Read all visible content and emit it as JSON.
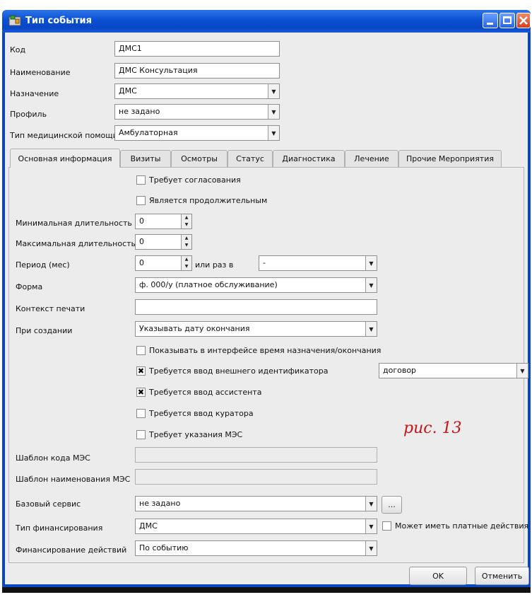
{
  "window": {
    "title": "Тип события"
  },
  "header_fields": {
    "code": {
      "label": "Код",
      "value": "ДМС1"
    },
    "name": {
      "label": "Наименование",
      "value": "ДМС Консультация"
    },
    "purpose": {
      "label": "Назначение",
      "value": "ДМС"
    },
    "profile": {
      "label": "Профиль",
      "value": "не задано"
    },
    "care_type": {
      "label": "Тип медицинской помощи",
      "value": "Амбулаторная"
    }
  },
  "tabs": [
    {
      "label": "Основная информация",
      "active": true
    },
    {
      "label": "Визиты"
    },
    {
      "label": "Осмотры"
    },
    {
      "label": "Статус"
    },
    {
      "label": "Диагностика"
    },
    {
      "label": "Лечение"
    },
    {
      "label": "Прочие Мероприятия"
    }
  ],
  "main": {
    "requires_approval": {
      "label": "Требует согласования",
      "checked": false
    },
    "is_long": {
      "label": "Является продолжительным",
      "checked": false
    },
    "min_duration": {
      "label": "Минимальная длительность",
      "value": "0"
    },
    "max_duration": {
      "label": "Максимальная длительность",
      "value": "0"
    },
    "period": {
      "label": "Период (мес)",
      "value": "0",
      "or_label": "или раз в",
      "or_value": "-"
    },
    "form": {
      "label": "Форма",
      "value": "ф. 000/у (платное обслуживание)"
    },
    "print_context": {
      "label": "Контекст печати",
      "value": ""
    },
    "on_create": {
      "label": "При создании",
      "value": "Указывать дату окончания"
    },
    "show_time": {
      "label": "Показывать в интерфейсе время назначения/окончания",
      "checked": false
    },
    "ext_id": {
      "label": "Требуется ввод внешнего идентификатора",
      "checked": true,
      "type_value": "договор"
    },
    "assistant": {
      "label": "Требуется ввод ассистента",
      "checked": true
    },
    "curator": {
      "label": "Требуется ввод куратора",
      "checked": false
    },
    "mes": {
      "label": "Требует указания МЭС",
      "checked": false
    },
    "mes_code_tpl": {
      "label": "Шаблон кода МЭС",
      "value": ""
    },
    "mes_name_tpl": {
      "label": "Шаблон наименования МЭС",
      "value": ""
    },
    "base_service": {
      "label": "Базовый сервис",
      "value": "не задано",
      "button": "..."
    },
    "financing": {
      "label": "Тип финансирования",
      "value": "ДМС",
      "paid_label": "Может иметь платные действия",
      "paid_checked": false
    },
    "action_financing": {
      "label": "Финансирование действий",
      "value": "По событию"
    }
  },
  "buttons": {
    "ok": "OK",
    "cancel": "Отменить"
  },
  "annotation": "рис. 13",
  "icons": {
    "window": "app-icon",
    "minimize": "minimize-icon",
    "maximize": "maximize-icon",
    "close": "close-icon"
  }
}
